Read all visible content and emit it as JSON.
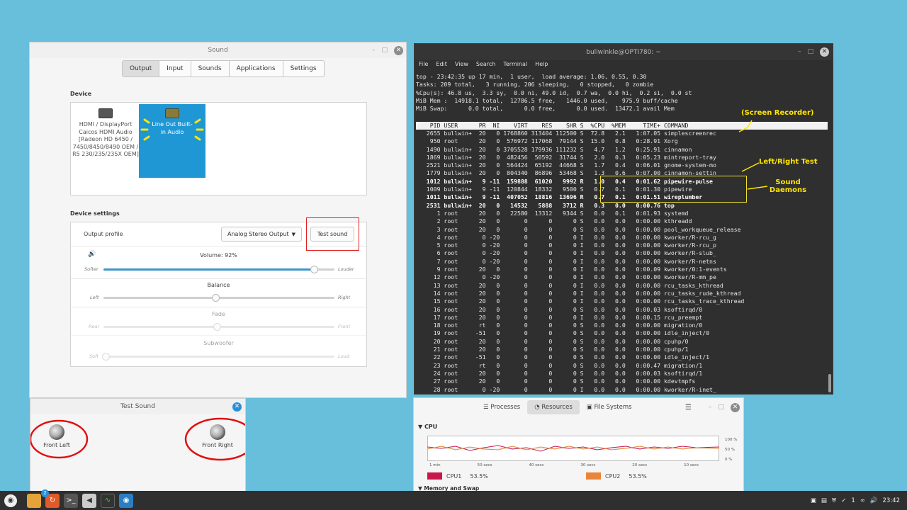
{
  "sound": {
    "title": "Sound",
    "tabs": [
      "Output",
      "Input",
      "Sounds",
      "Applications",
      "Settings"
    ],
    "device_heading": "Device",
    "devices": [
      {
        "label": "HDMI / DisplayPort Caicos HDMI Audio [Radeon HD 6450 / 7450/8450/8490 OEM / R5 230/235/235X OEM]"
      },
      {
        "label": "Line Out Built-in Audio"
      }
    ],
    "settings_heading": "Device settings",
    "output_profile_label": "Output profile",
    "output_profile_value": "Analog Stereo Output",
    "test_sound_button": "Test sound",
    "volume": {
      "label": "Volume: 92%",
      "min_label": "Softer",
      "max_label": "Louder",
      "level": 0.92
    },
    "balance": {
      "label": "Balance",
      "min_label": "Left",
      "max_label": "Right",
      "level": 0.5
    },
    "fade": {
      "label": "Fade",
      "min_label": "Rear",
      "max_label": "Front",
      "level": 0.5
    },
    "subwoofer": {
      "label": "Subwoofer",
      "min_label": "Soft",
      "max_label": "Loud",
      "level": 0.0
    }
  },
  "testsound": {
    "title": "Test Sound",
    "front_left": "Front Left",
    "front_right": "Front Right"
  },
  "terminal": {
    "title": "bullwinkle@OPTI780: ~",
    "menu": [
      "File",
      "Edit",
      "View",
      "Search",
      "Terminal",
      "Help"
    ],
    "summary": [
      "top - 23:42:35 up 17 min,  1 user,  load average: 1.06, 0.55, 0.30",
      "Tasks: 209 total,   3 running, 206 sleeping,   0 stopped,   0 zombie",
      "%Cpu(s): 46.8 us,  3.3 sy,  0.0 ni, 49.0 id,  0.7 wa,  0.0 hi,  0.2 si,  0.0 st",
      "MiB Mem :  14918.1 total,  12786.5 free,   1446.0 used,    975.9 buff/cache",
      "MiB Swap:      0.0 total,      0.0 free,      0.0 used.  13472.1 avail Mem"
    ],
    "header": "    PID USER      PR  NI    VIRT    RES    SHR S  %CPU  %MEM     TIME+ COMMAND",
    "rows_a": [
      "   2655 bullwin+  20   0 1768860 313404 112500 S  72.8   2.1   1:07.05 simplescreenrec",
      "    950 root      20   0  576972 117068  79144 S  15.0   0.8   0:28.91 Xorg",
      "   1490 bullwin+  20   0 3705528 179936 111232 S   4.7   1.2   0:25.91 cinnamon",
      "   1869 bullwin+  20   0  482456  50592  31744 S   2.0   0.3   0:05.23 mintreport-tray",
      "   2521 bullwin+  20   0  564424  65192  44668 S   1.7   0.4   0:06.01 gnome-system-mo",
      "   1779 bullwin+  20   0  804340  86896  53468 S   1.3   0.6   0:07.00 cinnamon-settin"
    ],
    "rows_bold1": "   1012 bullwin+   9 -11  159888  61020   9992 R   1.0   0.4   0:01.62 pipewire-pulse",
    "rows_plain": "   1009 bullwin+   9 -11  120844  18332   9500 S   0.7   0.1   0:01.30 pipewire",
    "rows_bold2": [
      "   1011 bullwin+   9 -11  407052  18816  13696 R   0.7   0.1   0:01.51 wireplumber",
      "   2531 bullwin+  20   0   14532   5888   3712 R   0.3   0.0   0:00.76 top"
    ],
    "rows_b": [
      "      1 root      20   0   22580  13312   9344 S   0.0   0.1   0:01.93 systemd",
      "      2 root      20   0       0      0      0 S   0.0   0.0   0:00.00 kthreadd",
      "      3 root      20   0       0      0      0 S   0.0   0.0   0:00.00 pool_workqueue_release",
      "      4 root       0 -20       0      0      0 I   0.0   0.0   0:00.00 kworker/R-rcu_g",
      "      5 root       0 -20       0      0      0 I   0.0   0.0   0:00.00 kworker/R-rcu_p",
      "      6 root       0 -20       0      0      0 I   0.0   0.0   0:00.00 kworker/R-slub_",
      "      7 root       0 -20       0      0      0 I   0.0   0.0   0:00.00 kworker/R-netns",
      "      9 root      20   0       0      0      0 I   0.0   0.0   0:00.09 kworker/0:1-events",
      "     12 root       0 -20       0      0      0 I   0.0   0.0   0:00.00 kworker/R-mm_pe",
      "     13 root      20   0       0      0      0 I   0.0   0.0   0:00.00 rcu_tasks_kthread",
      "     14 root      20   0       0      0      0 I   0.0   0.0   0:00.00 rcu_tasks_rude_kthread",
      "     15 root      20   0       0      0      0 I   0.0   0.0   0:00.00 rcu_tasks_trace_kthread",
      "     16 root      20   0       0      0      0 S   0.0   0.0   0:00.03 ksoftirqd/0",
      "     17 root      20   0       0      0      0 I   0.0   0.0   0:00.15 rcu_preempt",
      "     18 root      rt   0       0      0      0 S   0.0   0.0   0:00.00 migration/0",
      "     19 root     -51   0       0      0      0 S   0.0   0.0   0:00.00 idle_inject/0",
      "     20 root      20   0       0      0      0 S   0.0   0.0   0:00.00 cpuhp/0",
      "     21 root      20   0       0      0      0 S   0.0   0.0   0:00.00 cpuhp/1",
      "     22 root     -51   0       0      0      0 S   0.0   0.0   0:00.00 idle_inject/1",
      "     23 root      rt   0       0      0      0 S   0.0   0.0   0:00.47 migration/1",
      "     24 root      20   0       0      0      0 S   0.0   0.0   0:00.03 ksoftirqd/1",
      "     27 root      20   0       0      0      0 S   0.0   0.0   0:00.00 kdevtmpfs",
      "     28 root       0 -20       0      0      0 I   0.0   0.0   0:00.00 kworker/R-inet_"
    ],
    "annotations": {
      "recorder": "(Screen Recorder)",
      "lr_test": "Left/Right Test",
      "daemons": "Sound Daemons"
    }
  },
  "sysmon": {
    "tabs": [
      "Processes",
      "Resources",
      "File Systems"
    ],
    "cpu_heading": "CPU",
    "y_ticks": [
      "100 %",
      "50 %",
      "0 %"
    ],
    "x_ticks": [
      "1 min",
      "50 secs",
      "40 secs",
      "30 secs",
      "20 secs",
      "10 secs"
    ],
    "cpu1": {
      "name": "CPU1",
      "value": "53.5%",
      "color": "#c8174a"
    },
    "cpu2": {
      "name": "CPU2",
      "value": "53.5%",
      "color": "#e8853a"
    },
    "memory_heading": "Memory and Swap"
  },
  "taskbar": {
    "badge": "2",
    "tray_num": "1",
    "clock": "23:42"
  }
}
